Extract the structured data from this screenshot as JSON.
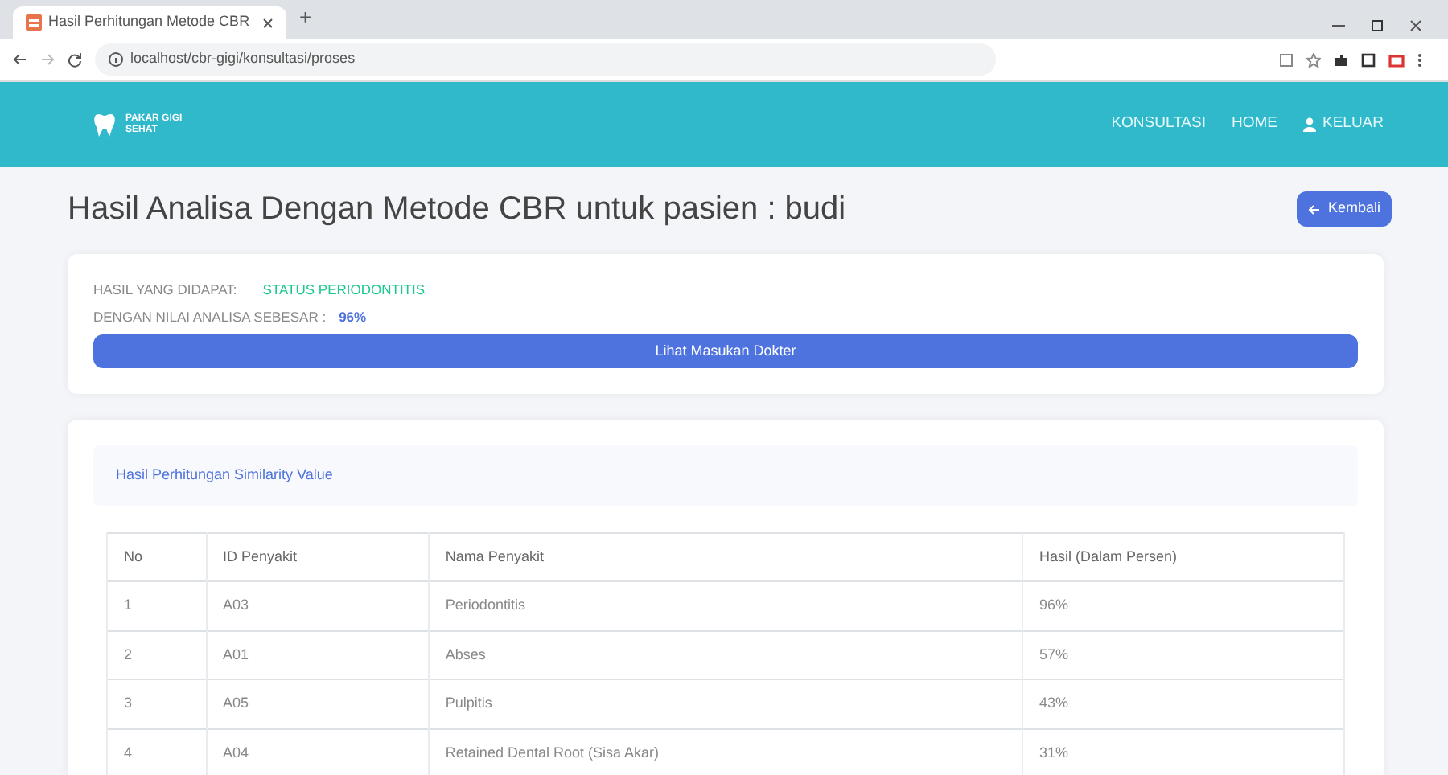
{
  "browser": {
    "tab_title": "Hasil Perhitungan Metode CBR",
    "new_tab": "+",
    "url": "localhost/cbr-gigi/konsultasi/proses"
  },
  "navbar": {
    "logo_lines": [
      "PAKAR GIGI",
      "SEHAT"
    ],
    "links": [
      {
        "label": "KONSULTASI",
        "kind": "text"
      },
      {
        "label": "HOME",
        "kind": "text"
      },
      {
        "label": "KELUAR",
        "kind": "user"
      }
    ]
  },
  "title": "Hasil Analisa Dengan Metode CBR untuk pasien : budi",
  "back_button": "Kembali",
  "result": {
    "label": "HASIL YANG DIDAPAT:",
    "value": "STATUS PERIODONTITIS",
    "score_label": "DENGAN NILAI ANALISA SEBESAR :",
    "score": "96%",
    "button": "Lihat Masukan Dokter"
  },
  "similarity": {
    "header": "Hasil Perhitungan Similarity Value",
    "table": {
      "columns": [
        "No",
        "ID Penyakit",
        "Nama Penyakit",
        "Hasil (Dalam Persen)"
      ],
      "rows": [
        [
          "1",
          "A03",
          "Periodontitis",
          "96%"
        ],
        [
          "2",
          "A01",
          "Abses",
          "57%"
        ],
        [
          "3",
          "A05",
          "Pulpitis",
          "43%"
        ],
        [
          "4",
          "A04",
          "Retained Dental Root (Sisa Akar)",
          "31%"
        ]
      ]
    }
  }
}
